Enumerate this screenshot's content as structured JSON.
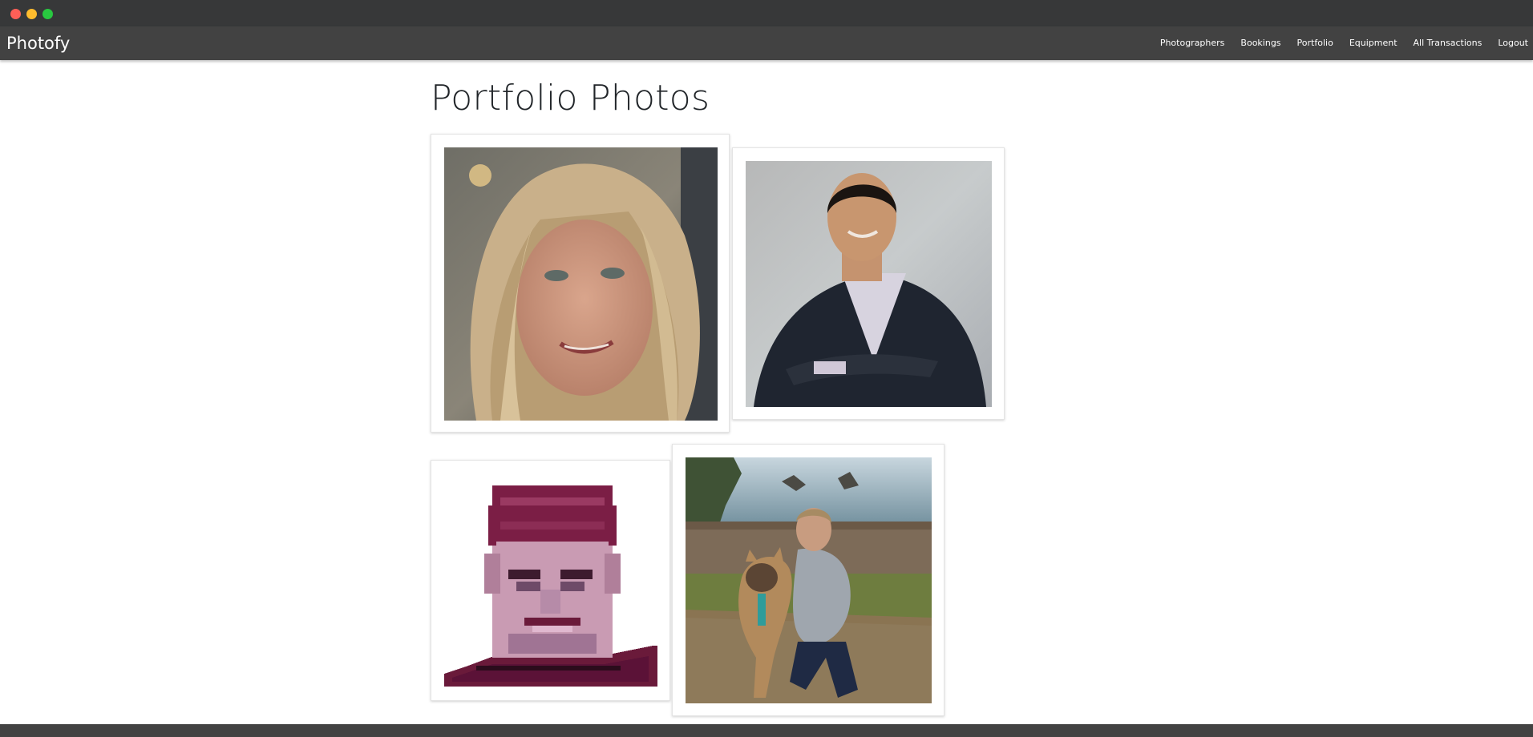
{
  "window": {
    "controls": [
      "close",
      "minimize",
      "maximize"
    ]
  },
  "navbar": {
    "brand": "Photofy",
    "links": [
      "Photographers",
      "Bookings",
      "Portfolio",
      "Equipment",
      "All Transactions",
      "Logout"
    ]
  },
  "main": {
    "title": "Portfolio Photos",
    "photos": [
      {
        "subject": "woman-selfie"
      },
      {
        "subject": "man-in-suit-headshot"
      },
      {
        "subject": "pixel-art-portrait"
      },
      {
        "subject": "woman-with-dog-by-coast"
      }
    ]
  }
}
